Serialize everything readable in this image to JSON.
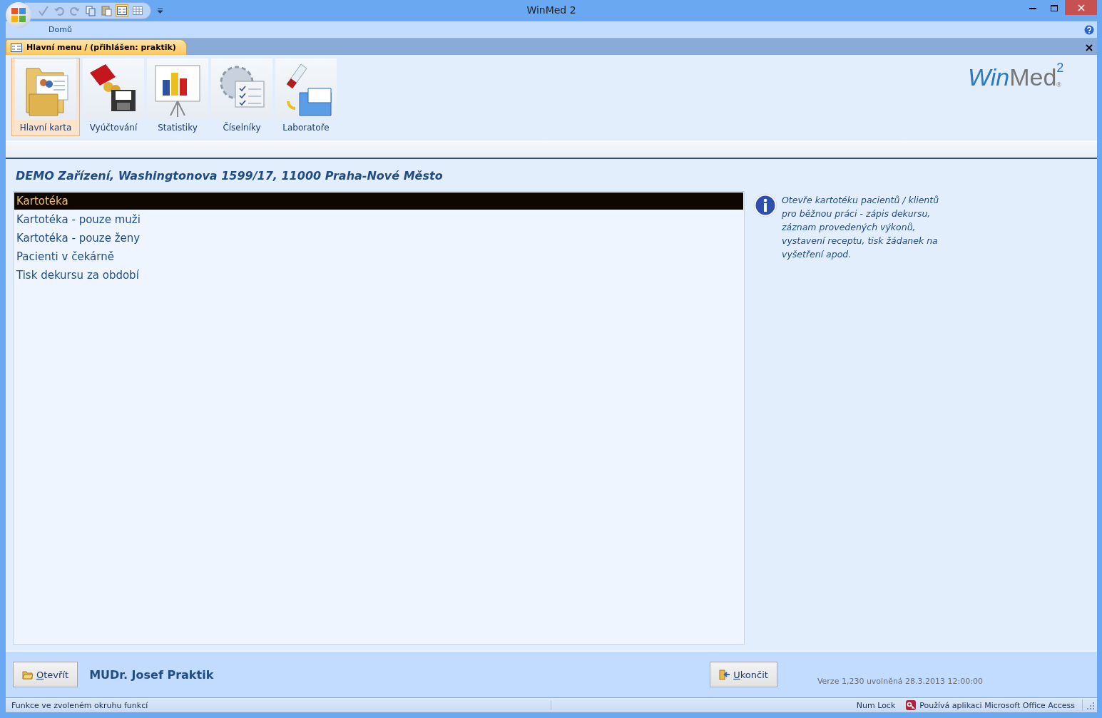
{
  "window": {
    "title": "WinMed 2"
  },
  "ribbon": {
    "tabs": [
      {
        "label": "Domů",
        "selected": true
      }
    ]
  },
  "document_tab": {
    "label": "Hlavní menu / (přihlášen: praktik)",
    "selected": true
  },
  "toolbar": [
    {
      "label": "Hlavní karta",
      "kind": "card",
      "selected": true
    },
    {
      "label": "Vyúčtování",
      "kind": "billing",
      "selected": false
    },
    {
      "label": "Statistiky",
      "kind": "stats",
      "selected": false
    },
    {
      "label": "Číselníky",
      "kind": "codes",
      "selected": false
    },
    {
      "label": "Laboratoře",
      "kind": "lab",
      "selected": false
    }
  ],
  "logo": {
    "part1": "Win",
    "part2": "Med",
    "sup": "2",
    "mark": "®"
  },
  "facility": "DEMO Zařízení, Washingtonova 1599/17, 11000 Praha-Nové Město",
  "menu_items": [
    {
      "label": "Kartotéka",
      "selected": true
    },
    {
      "label": "Kartotéka - pouze muži",
      "selected": false
    },
    {
      "label": "Kartotéka - pouze ženy",
      "selected": false
    },
    {
      "label": "Pacienti v čekárně",
      "selected": false
    },
    {
      "label": "Tisk dekursu za období",
      "selected": false
    }
  ],
  "description": "Otevře kartotéku pacientů / klientů pro běžnou práci - zápis dekursu, záznam provedených výkonů, vystavení receptu, tisk žádanek na vyšetření apod.",
  "footer": {
    "open_button": {
      "label": "Otevřít"
    },
    "user": "MUDr. Josef Praktik",
    "exit_button": {
      "label": "Ukončit"
    },
    "version": "Verze 1,230 uvolněná 28.3.2013 12:00:00"
  },
  "status_bar": {
    "message": "Funkce ve zvoleném okruhu funkcí",
    "num_lock": "Num Lock",
    "app": "Používá aplikaci Microsoft Office Access"
  }
}
